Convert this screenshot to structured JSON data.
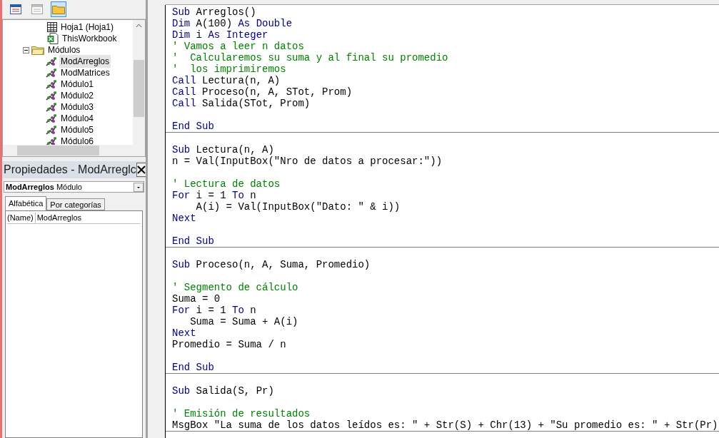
{
  "toolbar": [
    {
      "kind": "object",
      "selected": false
    },
    {
      "kind": "form",
      "selected": false
    },
    {
      "kind": "folders",
      "selected": true
    }
  ],
  "tree": [
    {
      "label": "Hoja1 (Hoja1)",
      "kind": "sheet"
    },
    {
      "label": "ThisWorkbook",
      "kind": "workbook"
    },
    {
      "label": "Módulos",
      "kind": "folder",
      "expanded": true,
      "children": [
        {
          "label": "ModArreglos",
          "kind": "module",
          "selected": true
        },
        {
          "label": "ModMatrices",
          "kind": "module",
          "selected": false
        },
        {
          "label": "Módulo1",
          "kind": "module",
          "selected": false
        },
        {
          "label": "Módulo2",
          "kind": "module",
          "selected": false
        },
        {
          "label": "Módulo3",
          "kind": "module",
          "selected": false
        },
        {
          "label": "Módulo4",
          "kind": "module",
          "selected": false
        },
        {
          "label": "Módulo5",
          "kind": "module",
          "selected": false
        },
        {
          "label": "Módulo6",
          "kind": "module",
          "selected": false
        }
      ]
    }
  ],
  "properties": {
    "title": "Propiedades - ModArreglc",
    "object": "**ModArreglos** Módulo",
    "tabs": [
      {
        "label": "Alfabética",
        "selected": true
      },
      {
        "label": "Por categorías",
        "selected": false
      }
    ],
    "rows": [
      {
        "name": "(Name)",
        "value": "ModArreglos"
      }
    ]
  },
  "procedures": [
    {
      "lines": [
        {
          "kind": "code",
          "tokens": [
            {
              "kind": "keyword",
              "text": "Sub"
            },
            {
              "kind": "plain",
              "text": " Arreglos()"
            }
          ]
        },
        {
          "kind": "code",
          "tokens": [
            {
              "kind": "keyword",
              "text": "Dim"
            },
            {
              "kind": "plain",
              "text": " A(100) "
            },
            {
              "kind": "keyword",
              "text": "As Double"
            }
          ]
        },
        {
          "kind": "code",
          "tokens": [
            {
              "kind": "keyword",
              "text": "Dim"
            },
            {
              "kind": "plain",
              "text": " i "
            },
            {
              "kind": "keyword",
              "text": "As Integer"
            }
          ]
        },
        {
          "kind": "code",
          "tokens": [
            {
              "kind": "comment",
              "text": "' Vamos a leer n datos"
            }
          ]
        },
        {
          "kind": "code",
          "tokens": [
            {
              "kind": "comment",
              "text": "'  Calcularemos su suma y al final su promedio"
            }
          ]
        },
        {
          "kind": "code",
          "tokens": [
            {
              "kind": "comment",
              "text": "'  los imprimiremos"
            }
          ]
        },
        {
          "kind": "code",
          "tokens": [
            {
              "kind": "keyword",
              "text": "Call"
            },
            {
              "kind": "plain",
              "text": " Lectura(n, A)"
            }
          ]
        },
        {
          "kind": "code",
          "tokens": [
            {
              "kind": "keyword",
              "text": "Call"
            },
            {
              "kind": "plain",
              "text": " Proceso(n, A, STot, Prom)"
            }
          ]
        },
        {
          "kind": "code",
          "tokens": [
            {
              "kind": "keyword",
              "text": "Call"
            },
            {
              "kind": "plain",
              "text": " Salida(STot, Prom)"
            }
          ]
        },
        {
          "kind": "blank"
        },
        {
          "kind": "code",
          "tokens": [
            {
              "kind": "keyword",
              "text": "End Sub"
            }
          ]
        }
      ]
    },
    {
      "lines": [
        {
          "kind": "blank"
        },
        {
          "kind": "code",
          "tokens": [
            {
              "kind": "keyword",
              "text": "Sub"
            },
            {
              "kind": "plain",
              "text": " Lectura(n, A)"
            }
          ]
        },
        {
          "kind": "code",
          "tokens": [
            {
              "kind": "plain",
              "text": "n = Val(InputBox(\"Nro de datos a procesar:\"))"
            }
          ]
        },
        {
          "kind": "blank"
        },
        {
          "kind": "code",
          "tokens": [
            {
              "kind": "comment",
              "text": "' Lectura de datos"
            }
          ]
        },
        {
          "kind": "code",
          "tokens": [
            {
              "kind": "keyword",
              "text": "For"
            },
            {
              "kind": "plain",
              "text": " i = 1 "
            },
            {
              "kind": "keyword",
              "text": "To"
            },
            {
              "kind": "plain",
              "text": " n"
            }
          ]
        },
        {
          "kind": "code",
          "tokens": [
            {
              "kind": "plain",
              "text": "    A(i) = Val(InputBox(\"Dato: \" & i))"
            }
          ]
        },
        {
          "kind": "code",
          "tokens": [
            {
              "kind": "keyword",
              "text": "Next"
            }
          ]
        },
        {
          "kind": "blank"
        },
        {
          "kind": "code",
          "tokens": [
            {
              "kind": "keyword",
              "text": "End Sub"
            }
          ]
        }
      ]
    },
    {
      "lines": [
        {
          "kind": "blank"
        },
        {
          "kind": "code",
          "tokens": [
            {
              "kind": "keyword",
              "text": "Sub"
            },
            {
              "kind": "plain",
              "text": " Proceso(n, A, Suma, Promedio)"
            }
          ]
        },
        {
          "kind": "blank"
        },
        {
          "kind": "code",
          "tokens": [
            {
              "kind": "comment",
              "text": "' Segmento de cálculo"
            }
          ]
        },
        {
          "kind": "code",
          "tokens": [
            {
              "kind": "plain",
              "text": "Suma = 0"
            }
          ]
        },
        {
          "kind": "code",
          "tokens": [
            {
              "kind": "keyword",
              "text": "For"
            },
            {
              "kind": "plain",
              "text": " i = 1 "
            },
            {
              "kind": "keyword",
              "text": "To"
            },
            {
              "kind": "plain",
              "text": " n"
            }
          ]
        },
        {
          "kind": "code",
          "tokens": [
            {
              "kind": "plain",
              "text": "   Suma = Suma + A(i)"
            }
          ]
        },
        {
          "kind": "code",
          "tokens": [
            {
              "kind": "keyword",
              "text": "Next"
            }
          ]
        },
        {
          "kind": "code",
          "tokens": [
            {
              "kind": "plain",
              "text": "Promedio = Suma / n"
            }
          ]
        },
        {
          "kind": "blank"
        },
        {
          "kind": "code",
          "tokens": [
            {
              "kind": "keyword",
              "text": "End Sub"
            }
          ]
        }
      ]
    },
    {
      "lines": [
        {
          "kind": "blank"
        },
        {
          "kind": "code",
          "tokens": [
            {
              "kind": "keyword",
              "text": "Sub"
            },
            {
              "kind": "plain",
              "text": " Salida(S, Pr)"
            }
          ]
        },
        {
          "kind": "blank"
        },
        {
          "kind": "code",
          "tokens": [
            {
              "kind": "comment",
              "text": "' Emisión de resultados"
            }
          ]
        },
        {
          "kind": "code",
          "tokens": [
            {
              "kind": "plain",
              "text": "MsgBox \"La suma de los datos leídos es: \" + Str(S) + Chr(13) + \"Su promedio es: \" + Str(Pr)"
            }
          ]
        }
      ]
    }
  ]
}
